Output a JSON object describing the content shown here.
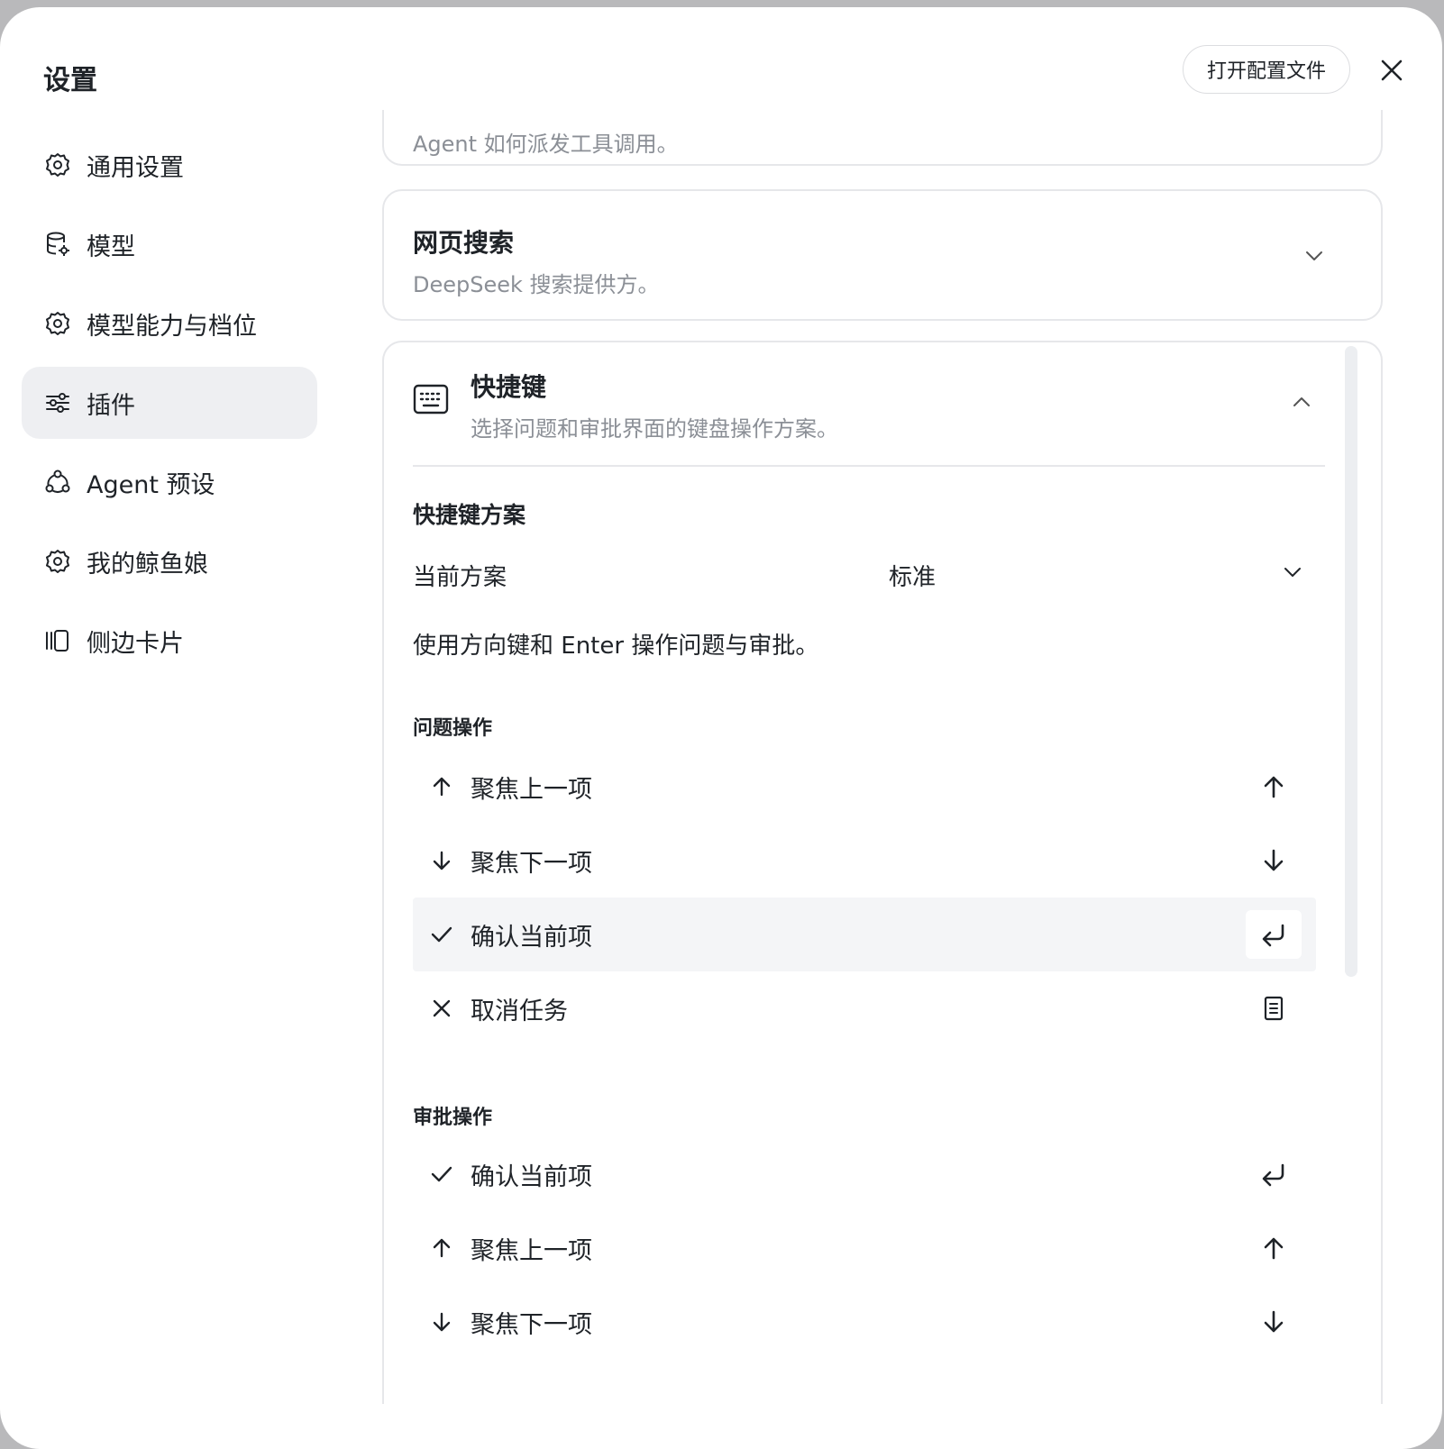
{
  "header": {
    "title": "设置",
    "open_config_label": "打开配置文件"
  },
  "sidebar": {
    "items": [
      {
        "label": "通用设置",
        "icon": "gear-icon",
        "active": false
      },
      {
        "label": "模型",
        "icon": "database-gear-icon",
        "active": false
      },
      {
        "label": "模型能力与档位",
        "icon": "gear-icon",
        "active": false
      },
      {
        "label": "插件",
        "icon": "sliders-icon",
        "active": true
      },
      {
        "label": "Agent 预设",
        "icon": "agent-network-icon",
        "active": false
      },
      {
        "label": "我的鲸鱼娘",
        "icon": "gear-icon",
        "active": false
      },
      {
        "label": "侧边卡片",
        "icon": "side-cards-icon",
        "active": false
      }
    ]
  },
  "cards": {
    "top_partial": {
      "description": "Agent 如何派发工具调用。"
    },
    "web_search": {
      "title": "网页搜索",
      "description": "DeepSeek 搜索提供方。"
    },
    "shortcuts": {
      "title": "快捷键",
      "description": "选择问题和审批界面的键盘操作方案。",
      "scheme_section_title": "快捷键方案",
      "current_scheme_label": "当前方案",
      "current_scheme_value": "标准",
      "scheme_description": "使用方向键和 Enter 操作问题与审批。",
      "question_group_label": "问题操作",
      "question_actions": [
        {
          "label": "聚焦上一项",
          "icon": "arrow-up-icon",
          "key": "arrow-up-key-icon"
        },
        {
          "label": "聚焦下一项",
          "icon": "arrow-down-icon",
          "key": "arrow-down-key-icon"
        },
        {
          "label": "确认当前项",
          "icon": "check-icon",
          "key": "enter-key-icon",
          "highlighted": true
        },
        {
          "label": "取消任务",
          "icon": "x-icon",
          "key": "document-key-icon"
        }
      ],
      "approval_group_label": "审批操作",
      "approval_actions": [
        {
          "label": "确认当前项",
          "icon": "check-icon",
          "key": "enter-key-icon"
        },
        {
          "label": "聚焦上一项",
          "icon": "arrow-up-icon",
          "key": "arrow-up-key-icon"
        },
        {
          "label": "聚焦下一项",
          "icon": "arrow-down-icon",
          "key": "arrow-down-key-icon"
        }
      ]
    }
  }
}
